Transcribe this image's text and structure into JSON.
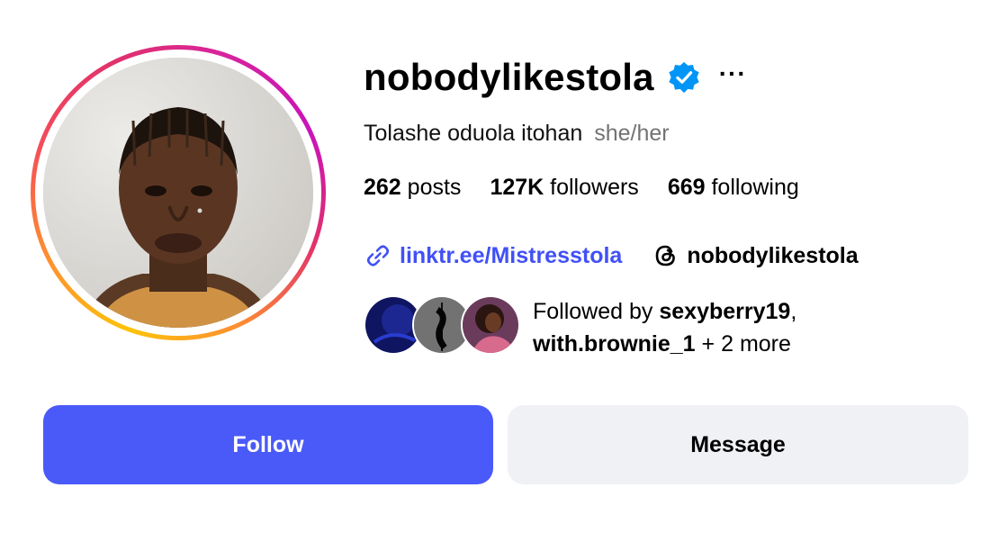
{
  "profile": {
    "username": "nobodylikestola",
    "verified": true,
    "more_icon": "more-horizontal-icon",
    "full_name": "Tolashe oduola itohan",
    "pronouns": "she/her"
  },
  "stats": {
    "posts_count": "262",
    "posts_label": "posts",
    "followers_count": "127K",
    "followers_label": "followers",
    "following_count": "669",
    "following_label": "following"
  },
  "links": {
    "website": "linktr.ee/Mistresstola",
    "threads_handle": "nobodylikestola"
  },
  "followed_by": {
    "prefix": "Followed by",
    "user1": "sexyberry19",
    "separator": ",",
    "user2": "with.brownie_1",
    "suffix": "+ 2 more"
  },
  "actions": {
    "follow_label": "Follow",
    "message_label": "Message"
  },
  "colors": {
    "accent": "#4a5af9",
    "link": "#4150f7",
    "verified": "#0095f6",
    "secondary_button": "#eff1f5"
  }
}
